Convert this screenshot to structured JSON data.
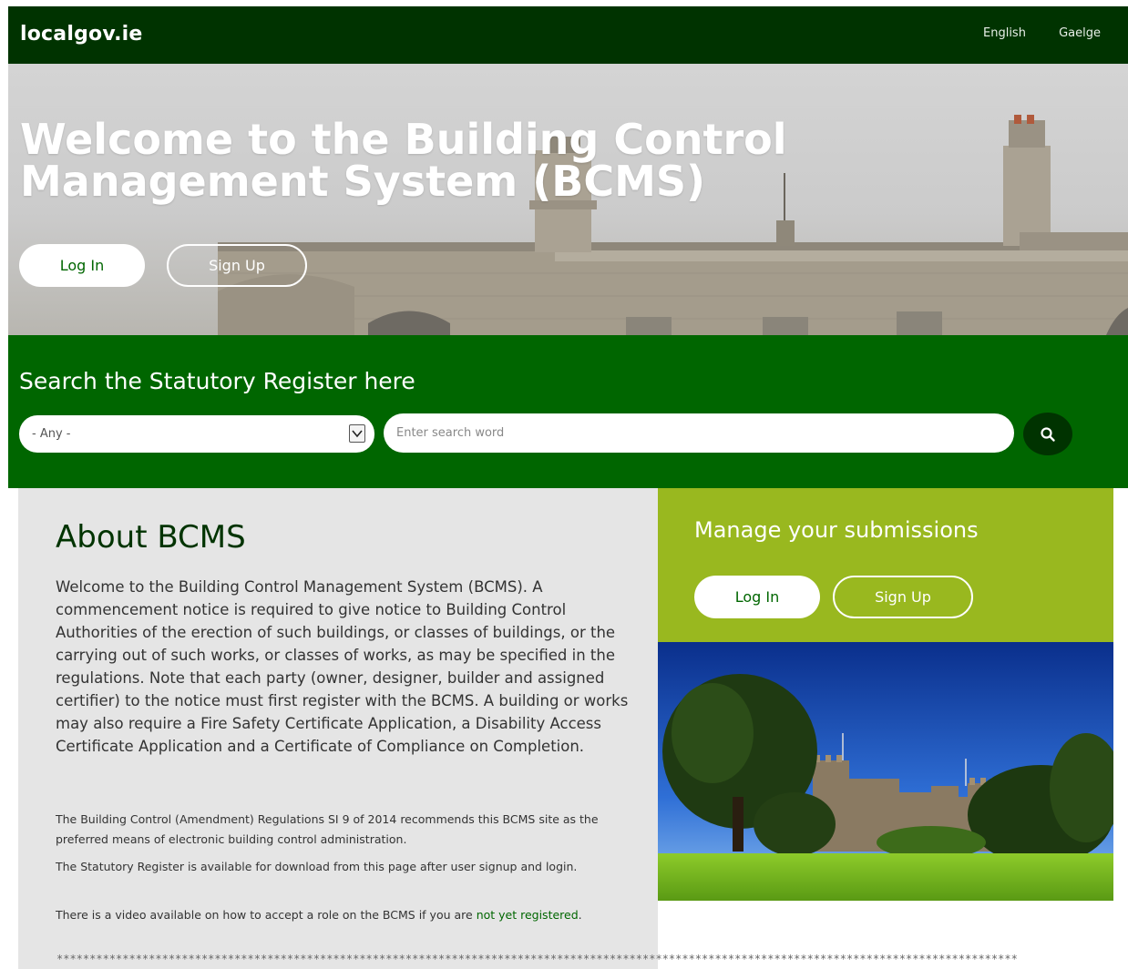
{
  "header": {
    "brand": "localgov.ie",
    "lang_english": "English",
    "lang_gaeilge": "Gaelge"
  },
  "hero": {
    "title": "Welcome to the Building Control Management System (BCMS)",
    "login_label": "Log In",
    "signup_label": "Sign Up"
  },
  "search": {
    "title": "Search the Statutory Register here",
    "select_value": "- Any -",
    "placeholder": "Enter search word",
    "button_icon": "search-icon"
  },
  "about": {
    "heading": "About BCMS",
    "lead": "Welcome to the Building Control Management System (BCMS). A commencement notice is required to give notice to Building Control Authorities of the erection of such buildings, or classes of buildings, or the carrying out of such works, or classes of works, as may be specified in the regulations. Note that each party (owner, designer, builder and assigned certifier) to the notice must first register with the BCMS. A building or works may also require a Fire Safety Certificate Application, a Disability Access Certificate Application and a Certificate of Compliance on Completion.",
    "para1": "The Building Control (Amendment) Regulations SI 9 of 2014 recommends this BCMS site as the preferred means of electronic building control administration.",
    "para2": "The Statutory Register is available for download from this page after user signup and login.",
    "para3_pre": "There is a video available on how to accept a role on the BCMS if you are ",
    "para3_link": "not yet registered",
    "para3_post": "."
  },
  "manage": {
    "heading": "Manage your submissions",
    "login_label": "Log In",
    "signup_label": "Sign Up"
  },
  "divider": "**************************************************************************************************************************************************",
  "colors": {
    "topbar": "#003300",
    "search_band": "#006600",
    "manage_panel": "#99b81f",
    "about_panel": "#e5e5e5"
  }
}
